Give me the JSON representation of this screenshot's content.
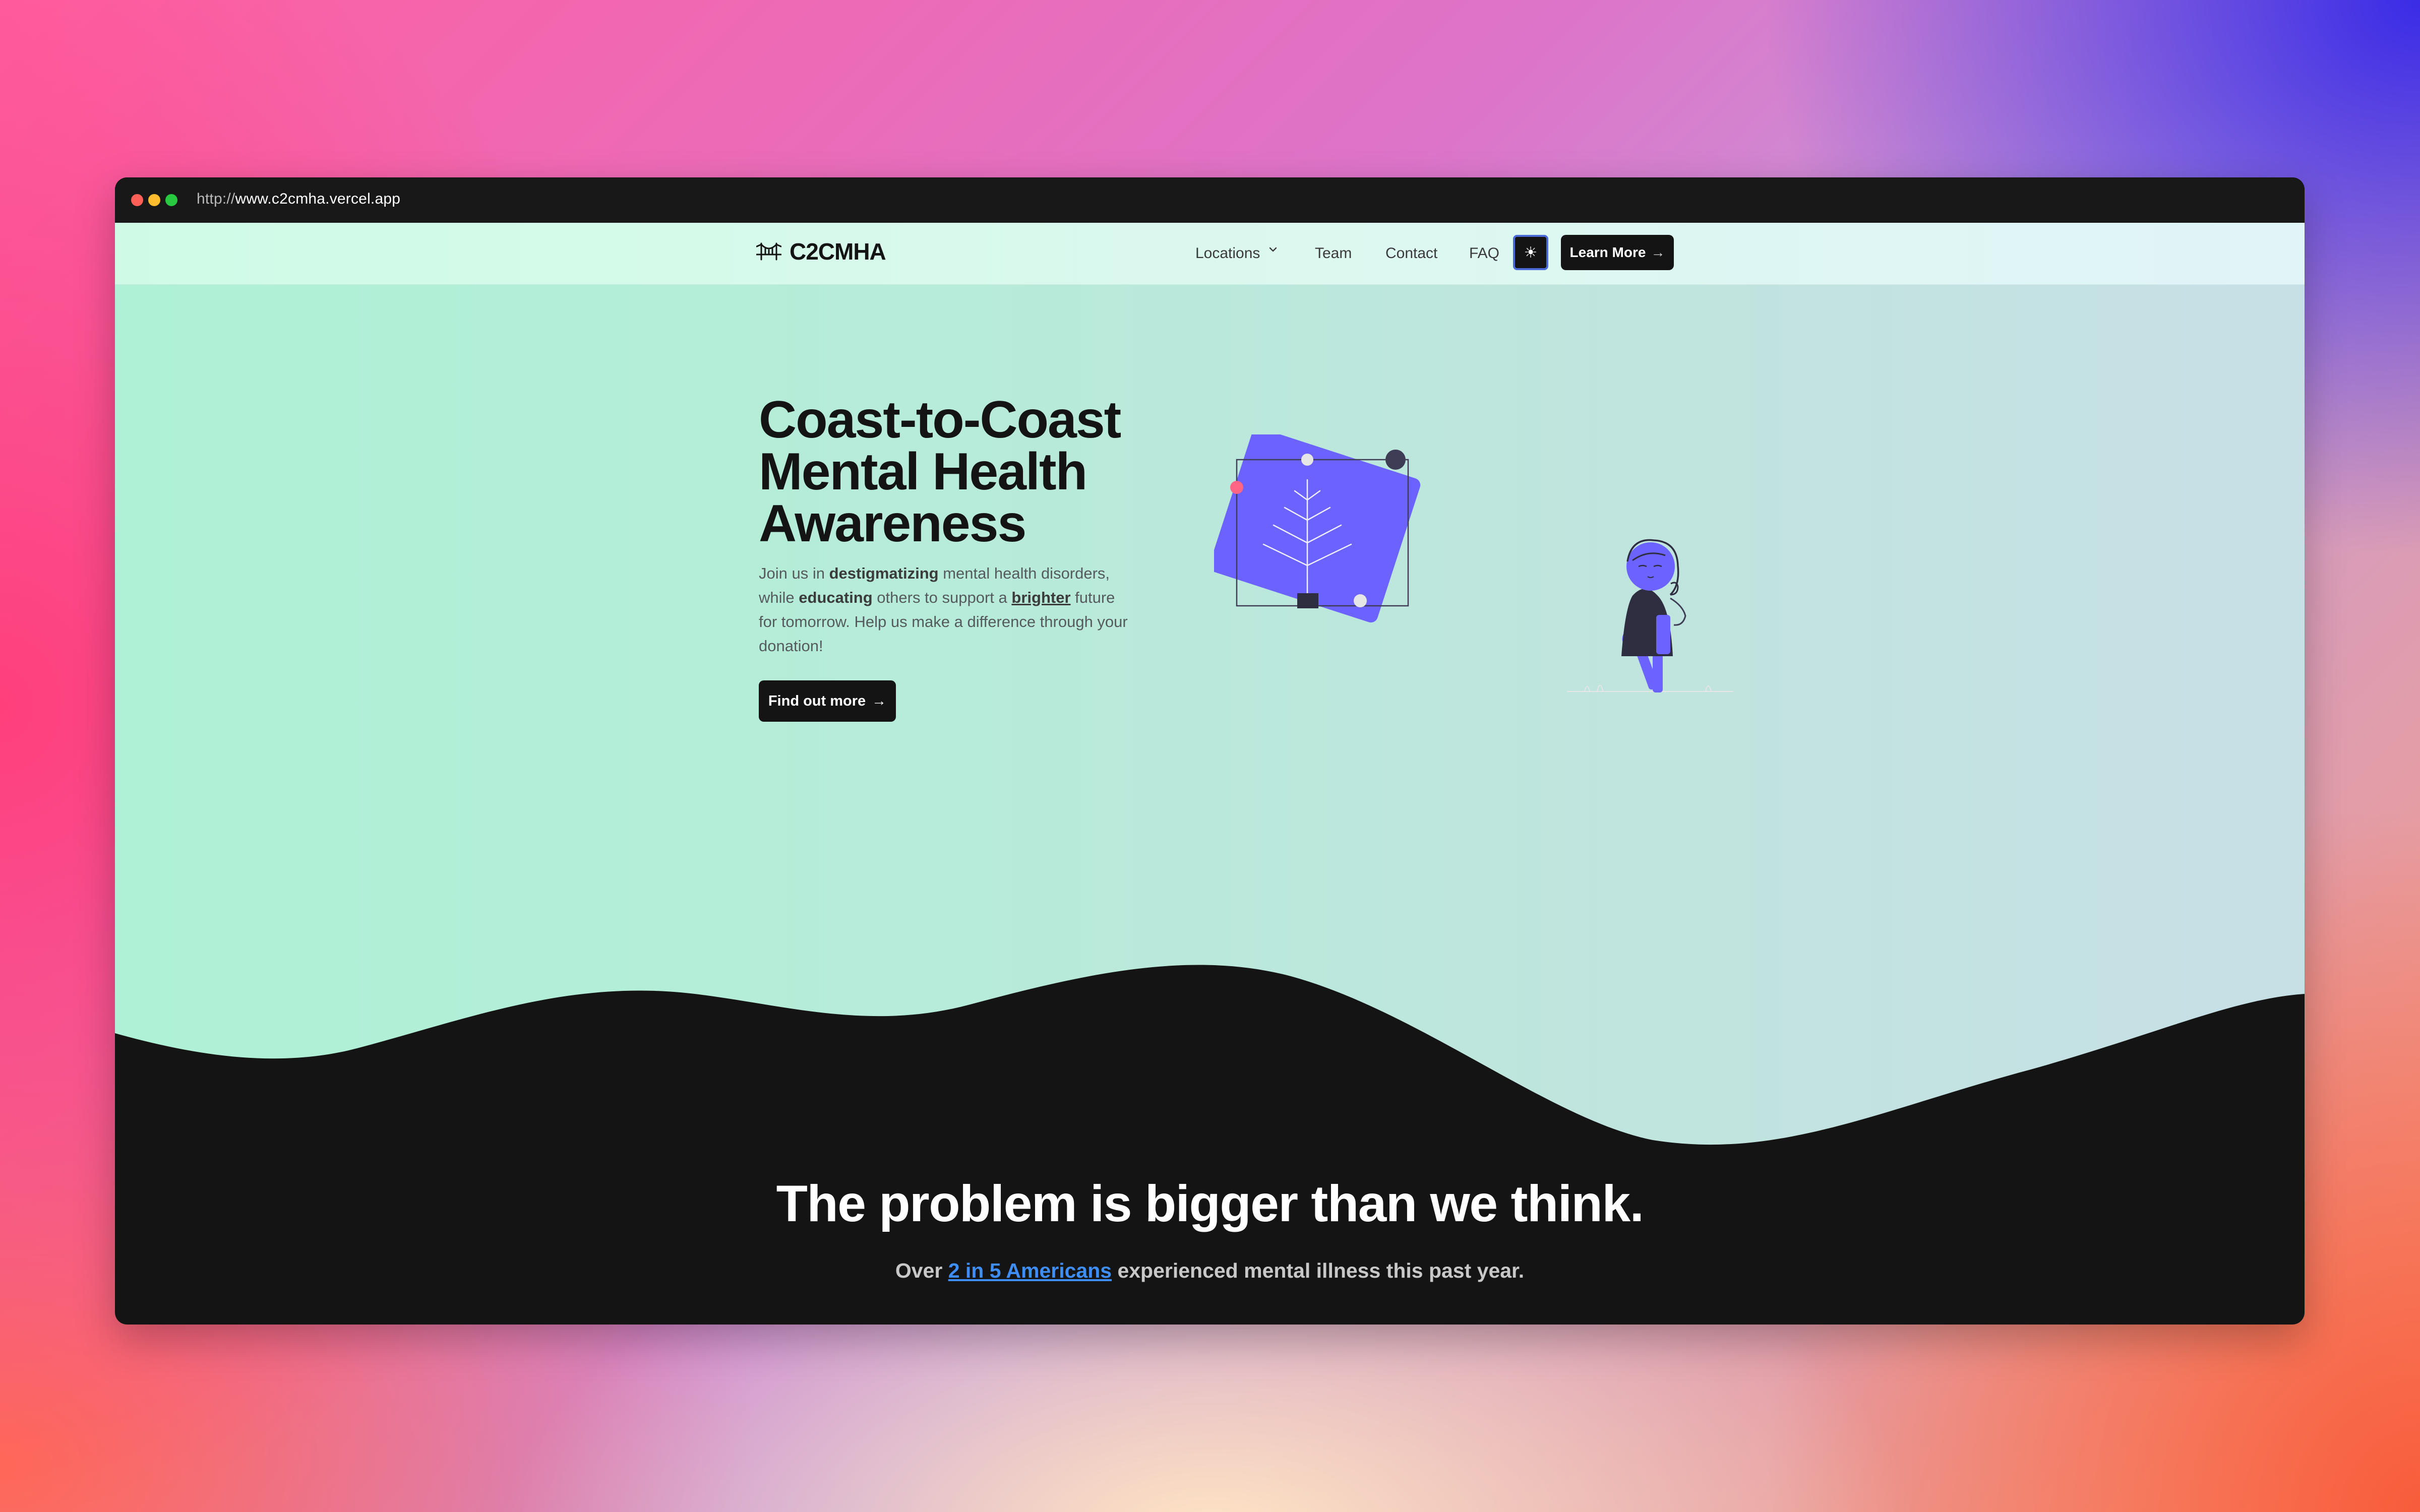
{
  "browser": {
    "url_protocol": "http://",
    "url_host": "www.c2cmha.vercel.app"
  },
  "nav": {
    "logo_icon": "bridge-icon",
    "logo_text": "C2CMHA",
    "items": [
      {
        "label": "Locations",
        "icon": "chevron-down-icon"
      },
      {
        "label": "Team"
      },
      {
        "label": "Contact"
      },
      {
        "label": "FAQ"
      }
    ],
    "theme_toggle_icon": "☀",
    "cta_label": "Learn More",
    "cta_icon": "→"
  },
  "hero": {
    "title_lines": [
      "Coast-to-Coast",
      "Mental Health",
      "Awareness"
    ],
    "desc": {
      "p1": "Join us in ",
      "b1": "destigmatizing",
      "p2": " mental health disorders, while ",
      "b2": "educating",
      "p3": " others to support a ",
      "b3": "brighter",
      "p4": " future for tomorrow. Help us make a difference through your donation!"
    },
    "button_label": "Find out more",
    "button_icon": "→",
    "illustration": "person-with-plant-frame-illustration"
  },
  "problem": {
    "title": "The problem is bigger than we think.",
    "sub_prefix": "Over ",
    "sub_link": "2 in 5 Americans",
    "sub_suffix": " experienced mental illness this past year."
  },
  "colors": {
    "accent": "#6c63ff",
    "dark": "#141414",
    "link": "#3f8ef5",
    "hero_bg_start": "#aef1d6",
    "hero_bg_end": "#c7e0e6"
  }
}
